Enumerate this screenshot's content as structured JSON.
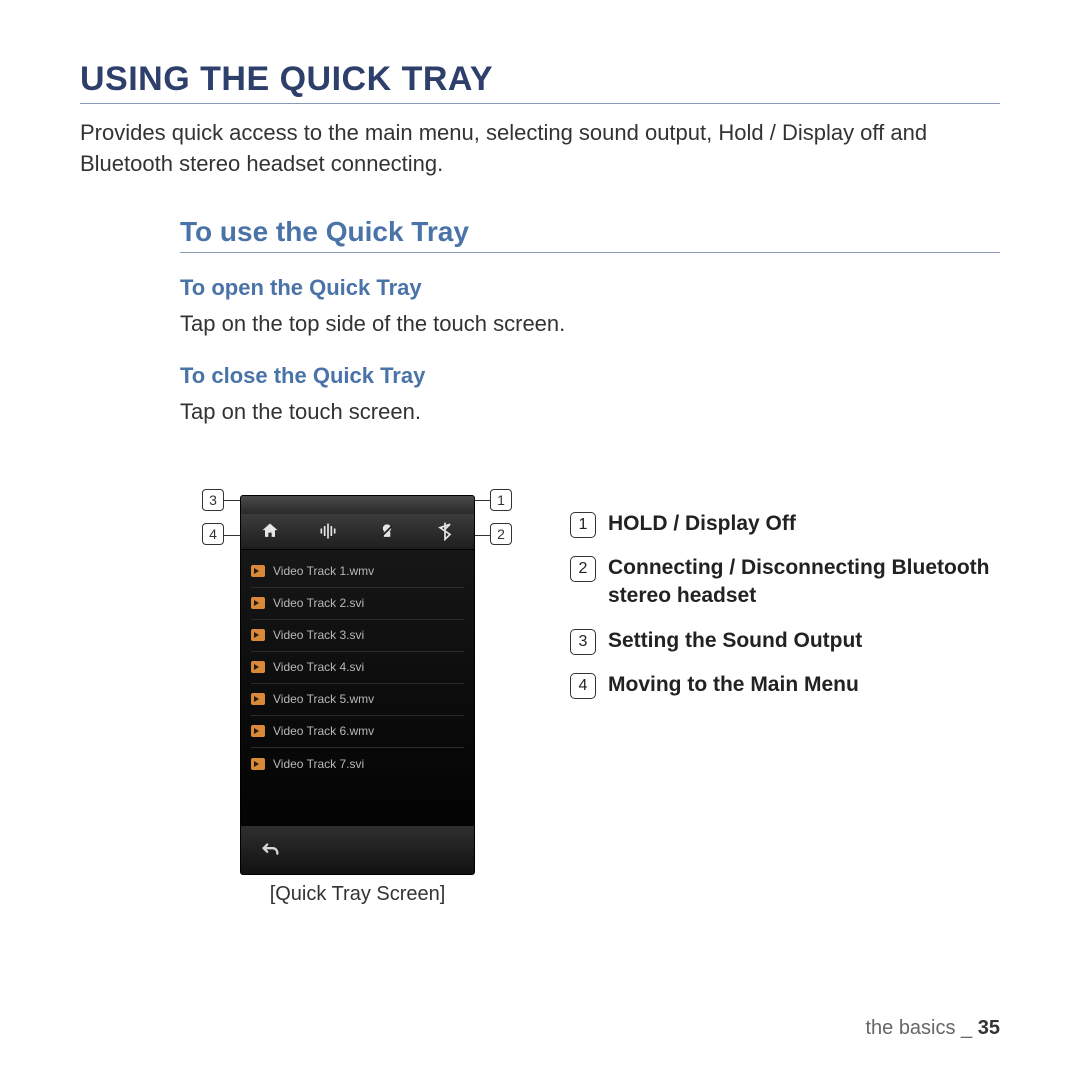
{
  "main_title": "USING THE QUICK TRAY",
  "intro": "Provides quick access to the main menu, selecting sound output, Hold / Display off and Bluetooth stereo headset connecting.",
  "section_title": "To use the Quick Tray",
  "open": {
    "title": "To open the Quick Tray",
    "text": "Tap on the top side of the touch screen."
  },
  "close": {
    "title": "To close the Quick Tray",
    "text": "Tap on the touch screen."
  },
  "phone": {
    "tracks": [
      "Video Track 1.wmv",
      "Video Track 2.svi",
      "Video Track 3.svi",
      "Video Track 4.svi",
      "Video Track 5.wmv",
      "Video Track 6.wmv",
      "Video Track 7.svi"
    ],
    "caption": "[Quick Tray Screen]"
  },
  "callouts": {
    "c1": "1",
    "c2": "2",
    "c3": "3",
    "c4": "4"
  },
  "legend": [
    {
      "num": "1",
      "text": "HOLD / Display Off"
    },
    {
      "num": "2",
      "text": "Connecting / Disconnecting Bluetooth stereo headset"
    },
    {
      "num": "3",
      "text": "Setting the Sound Output"
    },
    {
      "num": "4",
      "text": "Moving to the Main Menu"
    }
  ],
  "footer": {
    "label": "the basics _ ",
    "page": "35"
  }
}
